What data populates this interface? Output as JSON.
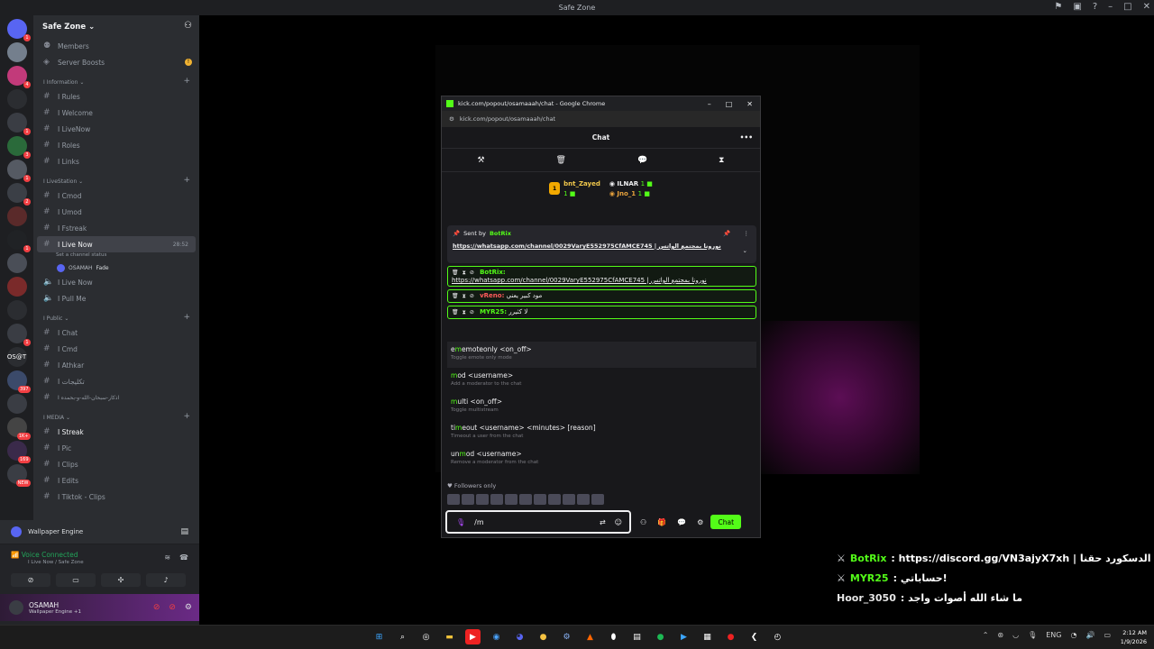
{
  "titlebar": {
    "title": "Safe Zone"
  },
  "server_rail": {
    "servers": [
      {
        "label": "",
        "badge": "1"
      },
      {
        "label": "",
        "badge": ""
      },
      {
        "label": "",
        "badge": "4"
      },
      {
        "label": "",
        "badge": ""
      },
      {
        "label": "",
        "badge": "1"
      },
      {
        "label": "",
        "badge": "3"
      },
      {
        "label": "",
        "badge": "1"
      },
      {
        "label": "",
        "badge": "2"
      },
      {
        "label": "",
        "badge": ""
      },
      {
        "label": "",
        "badge": "1"
      },
      {
        "label": "",
        "badge": ""
      },
      {
        "label": "",
        "badge": ""
      },
      {
        "label": "",
        "badge": ""
      },
      {
        "label": "",
        "badge": "1"
      },
      {
        "label": "OS@T",
        "badge": ""
      },
      {
        "label": "",
        "badge": "397"
      },
      {
        "label": "",
        "badge": ""
      },
      {
        "label": "",
        "badge": "1K+"
      },
      {
        "label": "",
        "badge": "169"
      },
      {
        "label": "",
        "badge": "NEW"
      }
    ]
  },
  "sidebar": {
    "guild_name": "Safe Zone",
    "top_items": [
      {
        "label": "Members",
        "badge": ""
      },
      {
        "label": "Server Boosts",
        "badge": "!"
      }
    ],
    "sections": [
      {
        "category": "I Information",
        "channels": [
          {
            "label": "I Rules",
            "right": ""
          },
          {
            "label": "I Welcome",
            "right": ""
          },
          {
            "label": "I LiveNow",
            "right": ""
          },
          {
            "label": "I Roles",
            "right": ""
          },
          {
            "label": "I Links",
            "right": ""
          }
        ]
      },
      {
        "category": "I LiveStation",
        "channels": [
          {
            "label": "I Cmod",
            "right": ""
          },
          {
            "label": "I Umod",
            "right": ""
          },
          {
            "label": "I Fstreak",
            "right": ""
          },
          {
            "label": "I Live Now",
            "right": "28:52",
            "active": true
          }
        ]
      }
    ],
    "live_now_status": "Set a channel status",
    "voice_user": {
      "name": "OSAMAH",
      "tag": "Fade"
    },
    "voice_channels": [
      {
        "label": "I Live Now"
      },
      {
        "label": "I Pull Me"
      }
    ],
    "public_category": "I Public",
    "public_channels": [
      {
        "label": "I Chat"
      },
      {
        "label": "I Cmd"
      },
      {
        "label": "I Athkar"
      },
      {
        "label": "I تكليجات"
      },
      {
        "label": "I اذكار-سبحان-الله-و-بحمده"
      }
    ],
    "media_category": "I MEDIA",
    "media_channels": [
      {
        "label": "I Streak"
      },
      {
        "label": "I Pic"
      },
      {
        "label": "I Clips"
      },
      {
        "label": "I Edits"
      },
      {
        "label": "I Tiktok - Clips"
      }
    ]
  },
  "bottom_panel": {
    "wallpaper_label": "Wallpaper Engine",
    "voice_connected": "Voice Connected",
    "voice_location": "I Live Now / Safe Zone",
    "user_name": "OSAMAH",
    "user_status": "Wallpaper Engine +1"
  },
  "chrome": {
    "window_title": "kick.com/popout/osamaaah/chat - Google Chrome",
    "url": "kick.com/popout/osamaaah/chat"
  },
  "chat": {
    "header": "Chat",
    "leaders": {
      "first": {
        "name": "bnt_Zayed",
        "count": "1"
      },
      "second": {
        "name": "ILNAR",
        "count": "1"
      },
      "third": {
        "name": "Jno_1",
        "count": "1"
      }
    },
    "pinned": {
      "sent_by": "Sent by",
      "author": "BotRix",
      "message": "https://whatsapp.com/channel/0029VaryE552975CfAMCE745 | نورونا بمجتمع الواتس"
    },
    "messages": [
      {
        "user": "BotRix:",
        "text": "https://whatsapp.com/channel/0029VaryE552975CfAMCE745 | نورونا بمجتمع الواتس",
        "color": "green"
      },
      {
        "user": "vReno:",
        "text": "مود كبير يعني",
        "color": "red"
      },
      {
        "user": "MYR25:",
        "text": "لا كثيرر",
        "color": "green"
      }
    ],
    "commands": [
      {
        "typed": "m",
        "rest": "emoteonly <on_off>",
        "desc": "Toggle emote only mode",
        "prefix": "e"
      },
      {
        "typed": "m",
        "rest": "od <username>",
        "desc": "Add a moderator to the chat",
        "prefix": ""
      },
      {
        "typed": "m",
        "rest": "ulti <on_off>",
        "desc": "Toggle multistream",
        "prefix": ""
      },
      {
        "typed": "m",
        "rest": "eout <username> <minutes> [reason]",
        "desc": "Timeout a user from the chat",
        "prefix": "ti"
      },
      {
        "typed": "m",
        "rest": "od <username>",
        "desc": "Remove a moderator from the chat",
        "prefix": "un"
      }
    ],
    "followers_only": "Followers only",
    "input_value": "/m",
    "send_label": "Chat"
  },
  "overlay": {
    "lines": [
      {
        "name": "BotRix",
        "text": ": https://discord.gg/VN3ajyX7xh | الله الدسكورد حقنا"
      },
      {
        "name": "MYR25",
        "text": ": حساباتي!"
      },
      {
        "name": "Hoor_3050",
        "text": ": ما شاء الله أصوات واجد"
      }
    ]
  },
  "taskbar": {
    "lang": "ENG",
    "time": "2:12 AM",
    "date": "1/9/2026"
  }
}
